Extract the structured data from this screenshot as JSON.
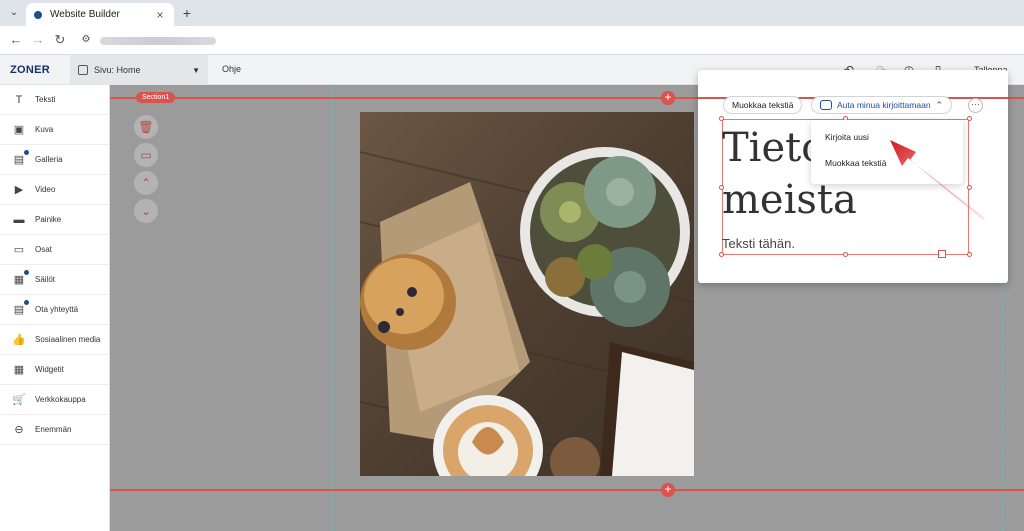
{
  "browser": {
    "tab_title": "Website Builder",
    "tab_close": "×",
    "new_tab": "+",
    "tab_menu": "⌄"
  },
  "app": {
    "logo": "ZONER",
    "page_selector": "Sivu: Home",
    "help": "Ohje",
    "save": "Tallenna"
  },
  "sidebar": {
    "items": [
      {
        "label": "Teksti",
        "icon": "text-icon",
        "glyph": "T"
      },
      {
        "label": "Kuva",
        "icon": "image-icon",
        "glyph": "▣"
      },
      {
        "label": "Galleria",
        "icon": "gallery-icon",
        "glyph": "▤"
      },
      {
        "label": "Video",
        "icon": "video-icon",
        "glyph": "▶"
      },
      {
        "label": "Painike",
        "icon": "button-icon",
        "glyph": "▬"
      },
      {
        "label": "Osat",
        "icon": "parts-icon",
        "glyph": "▭"
      },
      {
        "label": "Säilöt",
        "icon": "containers-icon",
        "glyph": "▦"
      },
      {
        "label": "Ota yhteyttä",
        "icon": "contact-icon",
        "glyph": "▤"
      },
      {
        "label": "Sosiaalinen media",
        "icon": "thumbs-up-icon",
        "glyph": "👍"
      },
      {
        "label": "Widgetit",
        "icon": "widgets-icon",
        "glyph": "▦"
      },
      {
        "label": "Verkkokauppa",
        "icon": "cart-icon",
        "glyph": "🛒"
      },
      {
        "label": "Enemmän",
        "icon": "more-circle-icon",
        "glyph": "⊖"
      }
    ]
  },
  "canvas": {
    "section_tag": "Section1",
    "plus": "+"
  },
  "editor": {
    "edit_text_chip": "Muokkaa tekstiä",
    "ai_chip": "Auta minua kirjoittamaan",
    "more": "···",
    "heading": "Tietoa meista",
    "body": "Teksti tähän.",
    "dropdown": [
      "Kirjoita uusi",
      "Muokkaa tekstiä"
    ]
  },
  "colors": {
    "accent": "#d9534f",
    "brand": "#17306b",
    "ai_blue": "#1e4fa2"
  }
}
